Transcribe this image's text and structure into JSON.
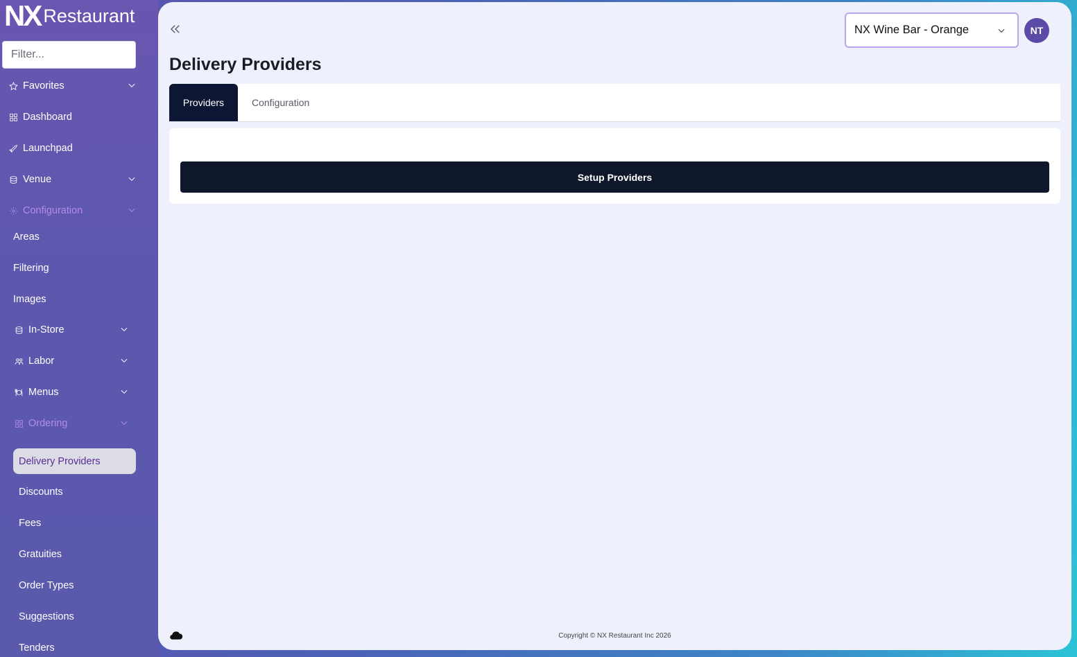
{
  "brand": {
    "mark": "NX",
    "word": "Restaurant"
  },
  "sidebar": {
    "filter_placeholder": "Filter...",
    "items": [
      {
        "label": "Favorites",
        "icon": "star-icon"
      },
      {
        "label": "Dashboard",
        "icon": "dashboard-icon"
      },
      {
        "label": "Launchpad",
        "icon": "rocket-icon"
      },
      {
        "label": "Venue",
        "icon": "venue-icon"
      },
      {
        "label": "Configuration",
        "icon": "gear-icon"
      },
      {
        "label": "Areas"
      },
      {
        "label": "Filtering"
      },
      {
        "label": "Images"
      },
      {
        "label": "In-Store",
        "icon": "store-icon"
      },
      {
        "label": "Labor",
        "icon": "people-icon"
      },
      {
        "label": "Menus",
        "icon": "utensils-icon"
      },
      {
        "label": "Ordering",
        "icon": "ordering-icon"
      },
      {
        "label": "Delivery Providers"
      },
      {
        "label": "Discounts"
      },
      {
        "label": "Fees"
      },
      {
        "label": "Gratuities"
      },
      {
        "label": "Order Types"
      },
      {
        "label": "Suggestions"
      },
      {
        "label": "Tenders"
      }
    ]
  },
  "header": {
    "venue": "NX Wine Bar - Orange",
    "avatar_initials": "NT"
  },
  "main": {
    "title": "Delivery Providers",
    "tabs": [
      {
        "label": "Providers"
      },
      {
        "label": "Configuration"
      }
    ],
    "setup_button": "Setup Providers"
  },
  "footer": {
    "copyright": "Copyright © NX Restaurant Inc 2026"
  },
  "colors": {
    "accent": "#0f172a",
    "muted_section": "#b58ae8",
    "avatar": "#5b4aa6"
  }
}
